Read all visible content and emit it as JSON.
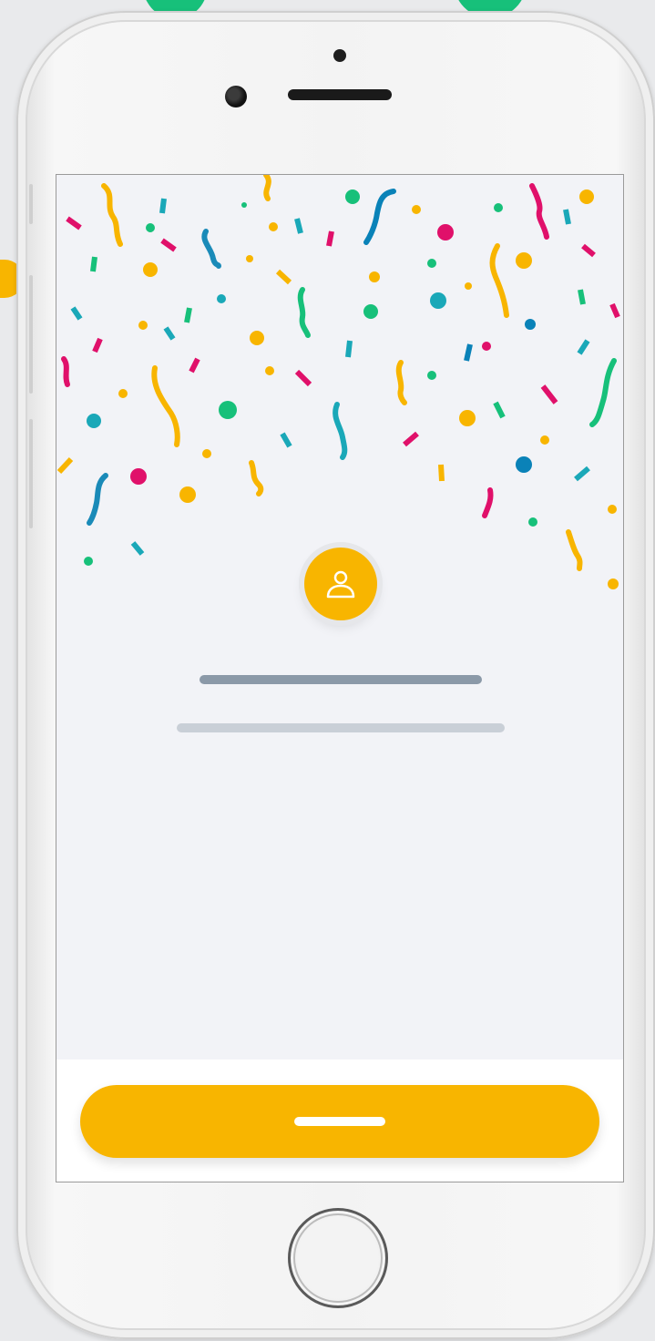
{
  "app": {
    "accent_color": "#f8b500",
    "screen_background": "#f2f3f7",
    "placeholder_title_color": "#8b99a8",
    "placeholder_subtitle_color": "#c9cfd7"
  },
  "avatar": {
    "icon": "user-icon"
  },
  "confetti_colors": [
    "#f8b500",
    "#e0106a",
    "#17c07a",
    "#1aa8b8",
    "#0a82b8"
  ],
  "device": {
    "home_button_icon": "home-button"
  }
}
